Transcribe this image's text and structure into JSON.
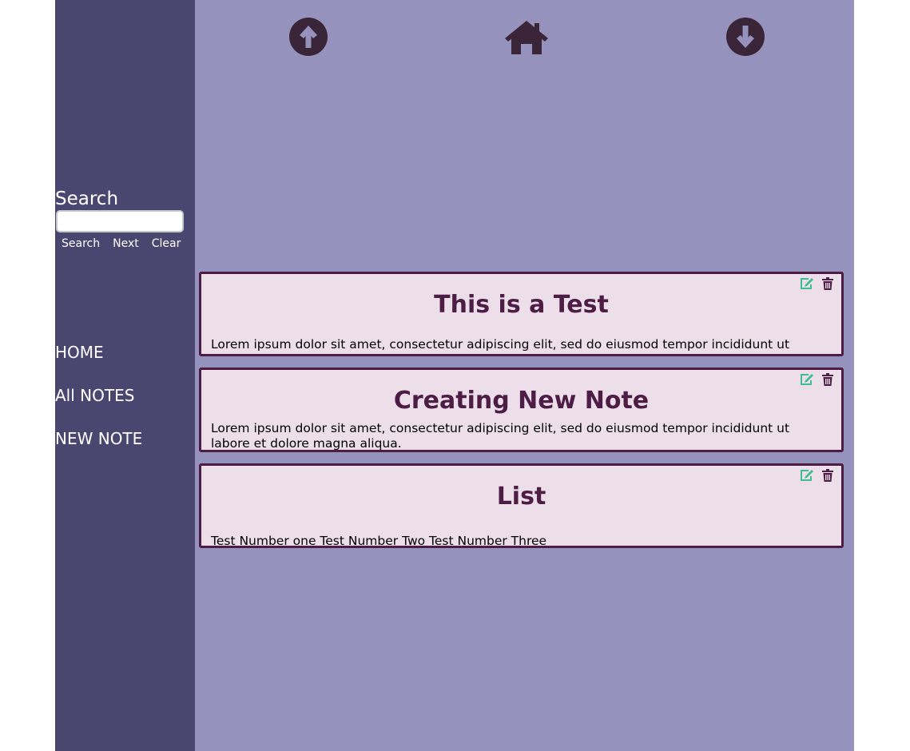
{
  "sidebar": {
    "search_title": "Search",
    "search_input_value": "",
    "search_button": "Search",
    "next_button": "Next",
    "clear_button": "Clear",
    "nav": [
      "HOME",
      "All NOTES",
      "NEW NOTE"
    ]
  },
  "topbar": {
    "icons": [
      "arrow-up-circle-icon",
      "home-icon",
      "arrow-down-circle-icon"
    ]
  },
  "notes": [
    {
      "title": "This is a Test",
      "body": "Lorem ipsum dolor sit amet, consectetur adipiscing elit, sed do eiusmod tempor incididunt ut labore et dolore magna aliqua. Ultrices tincidunt arcu non sodales neque sodales. Mattis vulputate enim nulla aliquet"
    },
    {
      "title": "Creating New Note",
      "body": "Lorem ipsum dolor sit amet, consectetur adipiscing elit, sed do eiusmod tempor incididunt ut labore et dolore magna aliqua."
    },
    {
      "title": "List",
      "body": "Test Number one Test Number Two Test Number Three"
    }
  ],
  "colors": {
    "sidebar_bg": "#4a4670",
    "main_bg": "#9593be",
    "note_bg": "#ecdfe9",
    "note_border": "#4d1d45",
    "edit_icon": "#3fbf8f",
    "delete_icon": "#4d1d45"
  }
}
